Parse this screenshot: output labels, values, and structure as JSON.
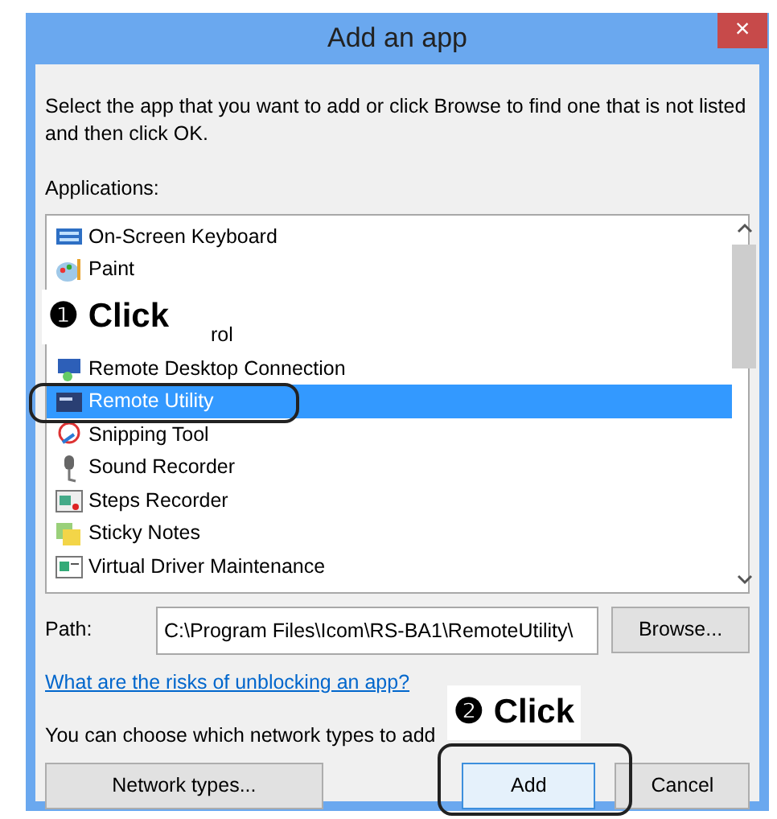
{
  "window": {
    "title": "Add an app",
    "close": "×"
  },
  "instructions": "Select the app that you want to add or click Browse to find one that is not listed and then click OK.",
  "applications": {
    "label": "Applications:",
    "items": [
      {
        "kind": "app",
        "label": "On-Screen Keyboard",
        "selected": false
      },
      {
        "kind": "app",
        "label": "Paint",
        "selected": false
      },
      {
        "kind": "covered",
        "label": "rol",
        "selected": false
      },
      {
        "kind": "app",
        "label": "Remote Desktop Connection",
        "selected": false
      },
      {
        "kind": "app",
        "label": "Remote Utility",
        "selected": true
      },
      {
        "kind": "app",
        "label": "Snipping Tool",
        "selected": false
      },
      {
        "kind": "app",
        "label": "Sound Recorder",
        "selected": false
      },
      {
        "kind": "app",
        "label": "Steps Recorder",
        "selected": false
      },
      {
        "kind": "app",
        "label": "Sticky Notes",
        "selected": false
      },
      {
        "kind": "app",
        "label": "Virtual Driver Maintenance",
        "selected": false
      }
    ]
  },
  "path": {
    "label": "Path:",
    "value": "C:\\Program Files\\Icom\\RS-BA1\\RemoteUtility\\"
  },
  "browse_button": "Browse...",
  "risks_link": "What are the risks of unblocking an app?",
  "network_note": "You can choose which network types to add",
  "buttons": [
    {
      "label": "Network types...",
      "focused": false
    },
    {
      "label": "Add",
      "focused": true
    },
    {
      "label": "Cancel",
      "focused": false
    }
  ],
  "annotations": [
    {
      "text": "❶ Click"
    },
    {
      "text": "❷ Click"
    }
  ]
}
